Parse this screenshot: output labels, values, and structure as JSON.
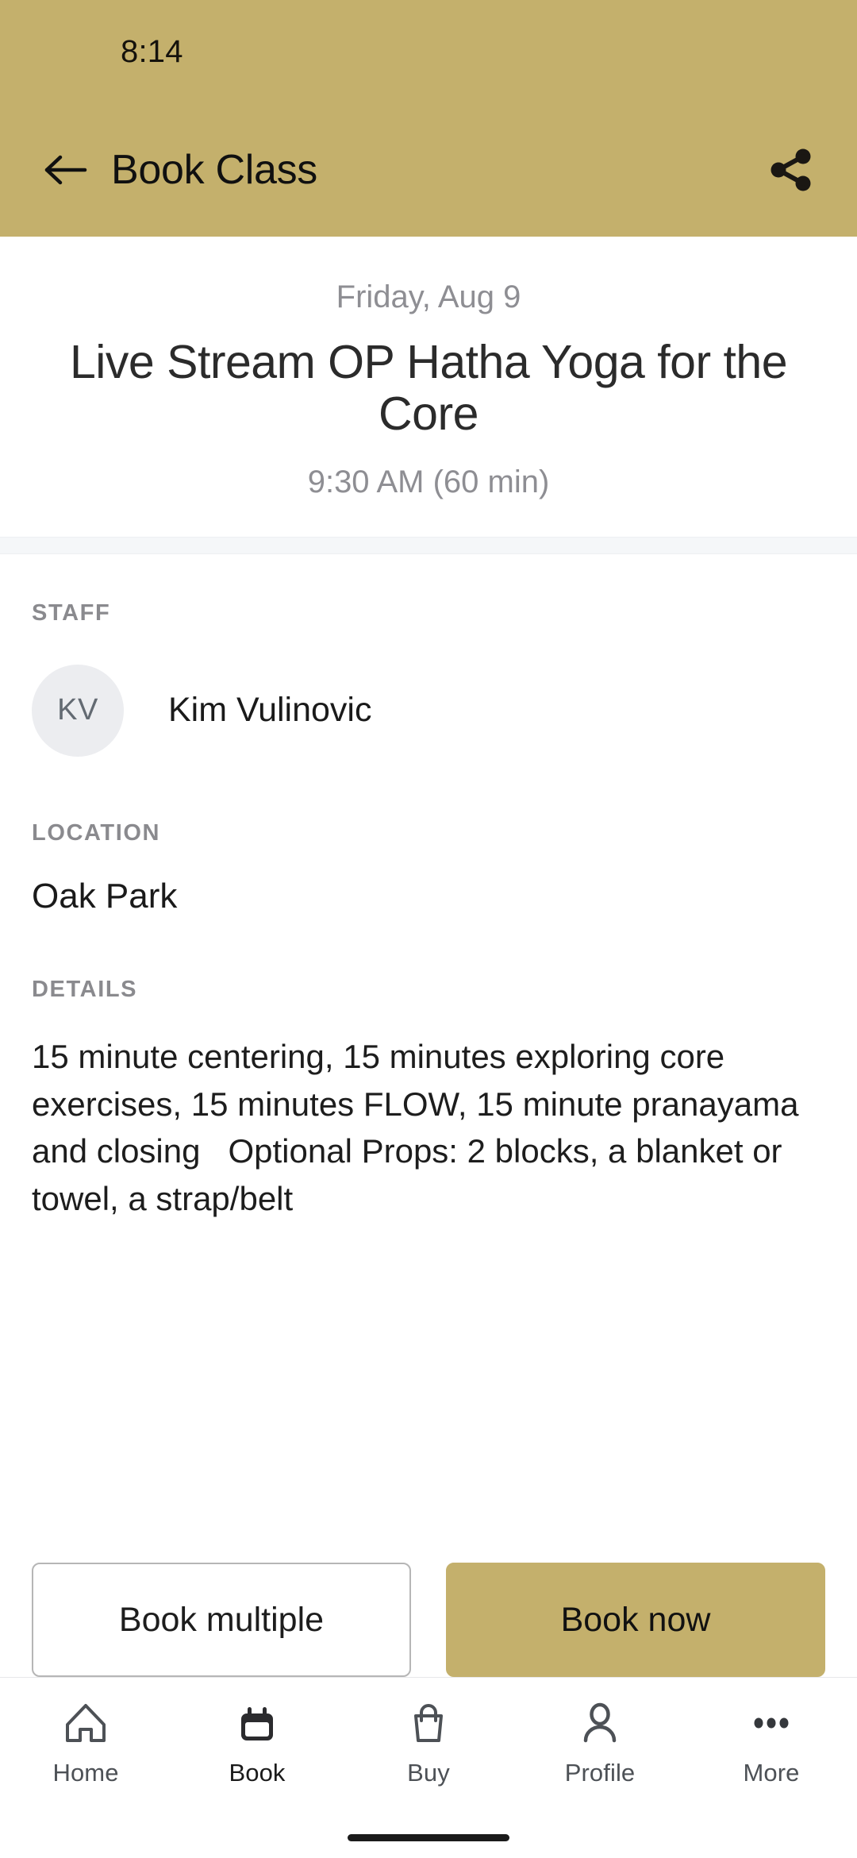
{
  "status_bar": {
    "time": "8:14"
  },
  "app_bar": {
    "title": "Book Class",
    "back_icon": "arrow-left-icon",
    "share_icon": "share-icon",
    "background_color": "#c4b06c"
  },
  "class_header": {
    "date": "Friday, Aug 9",
    "title": "Live Stream OP Hatha Yoga for the Core",
    "time": "9:30 AM (60 min)"
  },
  "sections": {
    "staff": {
      "label": "STAFF",
      "avatar_initials": "KV",
      "name": "Kim Vulinovic"
    },
    "location": {
      "label": "LOCATION",
      "value": "Oak Park"
    },
    "details": {
      "label": "DETAILS",
      "text": "15 minute centering, 15 minutes exploring core exercises, 15 minutes FLOW, 15 minute pranayama and closing   Optional Props: 2 blocks, a blanket or towel, a strap/belt"
    }
  },
  "actions": {
    "book_multiple_label": "Book multiple",
    "book_now_label": "Book now",
    "primary_color": "#c4b06c"
  },
  "bottom_nav": {
    "items": [
      {
        "label": "Home",
        "icon": "home-icon",
        "active": false
      },
      {
        "label": "Book",
        "icon": "calendar-icon",
        "active": true
      },
      {
        "label": "Buy",
        "icon": "bag-icon",
        "active": false
      },
      {
        "label": "Profile",
        "icon": "person-icon",
        "active": false
      },
      {
        "label": "More",
        "icon": "ellipsis-icon",
        "active": false
      }
    ]
  }
}
